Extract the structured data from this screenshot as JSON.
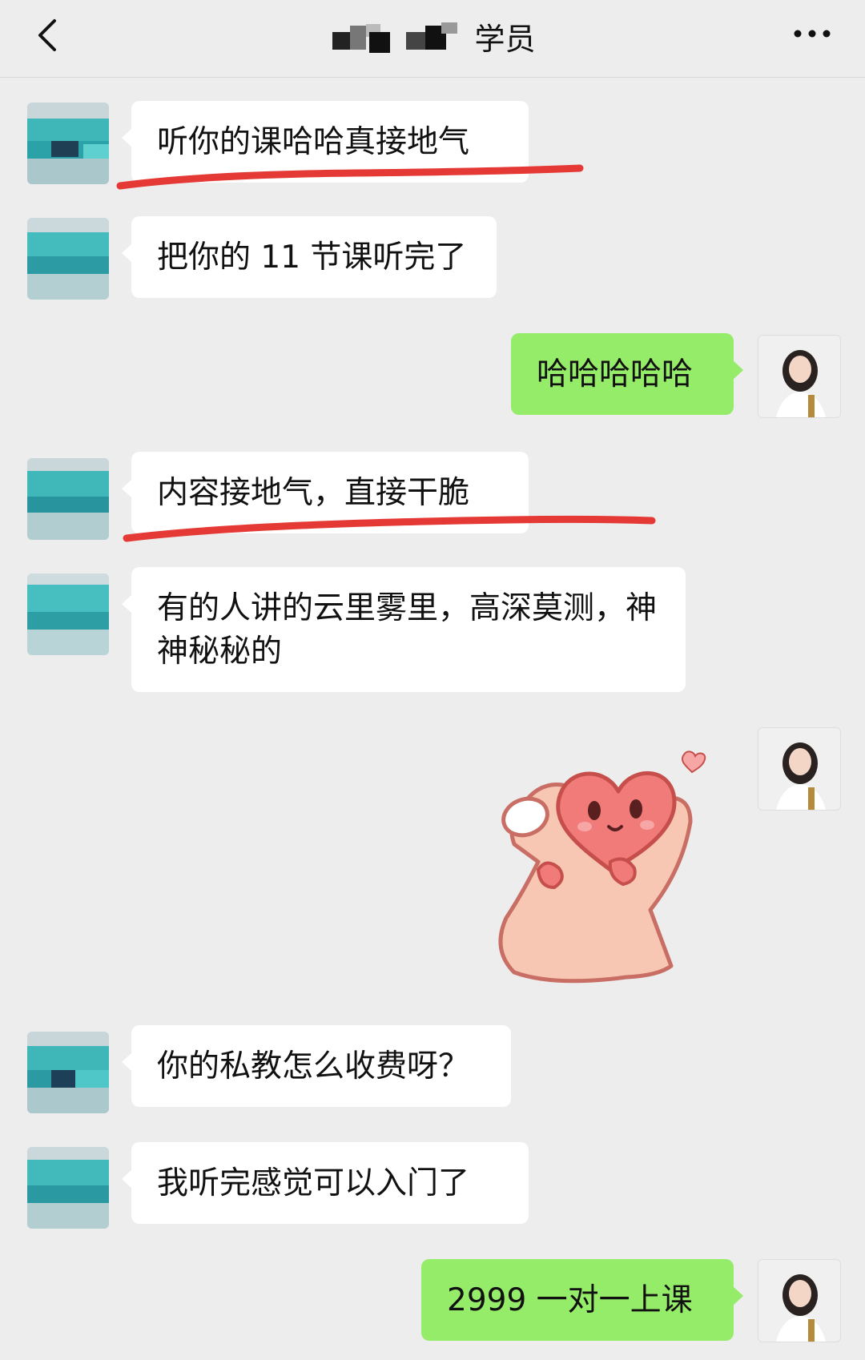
{
  "header": {
    "title": "学员",
    "back_icon": "chevron-left-icon",
    "more_icon": "more-dots-icon"
  },
  "messages": [
    {
      "side": "left",
      "text": "听你的课哈哈真接地气"
    },
    {
      "side": "left",
      "text": "把你的 11 节课听完了"
    },
    {
      "side": "right",
      "text": "哈哈哈哈哈"
    },
    {
      "side": "left",
      "text": "内容接地气，直接干脆"
    },
    {
      "side": "left",
      "text": "有的人讲的云里雾里，高深莫测，神神秘秘的"
    },
    {
      "side": "right",
      "type": "sticker",
      "sticker": "heart-finger-sticker"
    },
    {
      "side": "left",
      "text": "你的私教怎么收费呀？"
    },
    {
      "side": "left",
      "text": "我听完感觉可以入门了"
    },
    {
      "side": "right",
      "text": "2999 一对一上课"
    }
  ],
  "colors": {
    "background": "#ededed",
    "left_bubble": "#ffffff",
    "right_bubble": "#95ec69",
    "underline": "#e53935"
  }
}
